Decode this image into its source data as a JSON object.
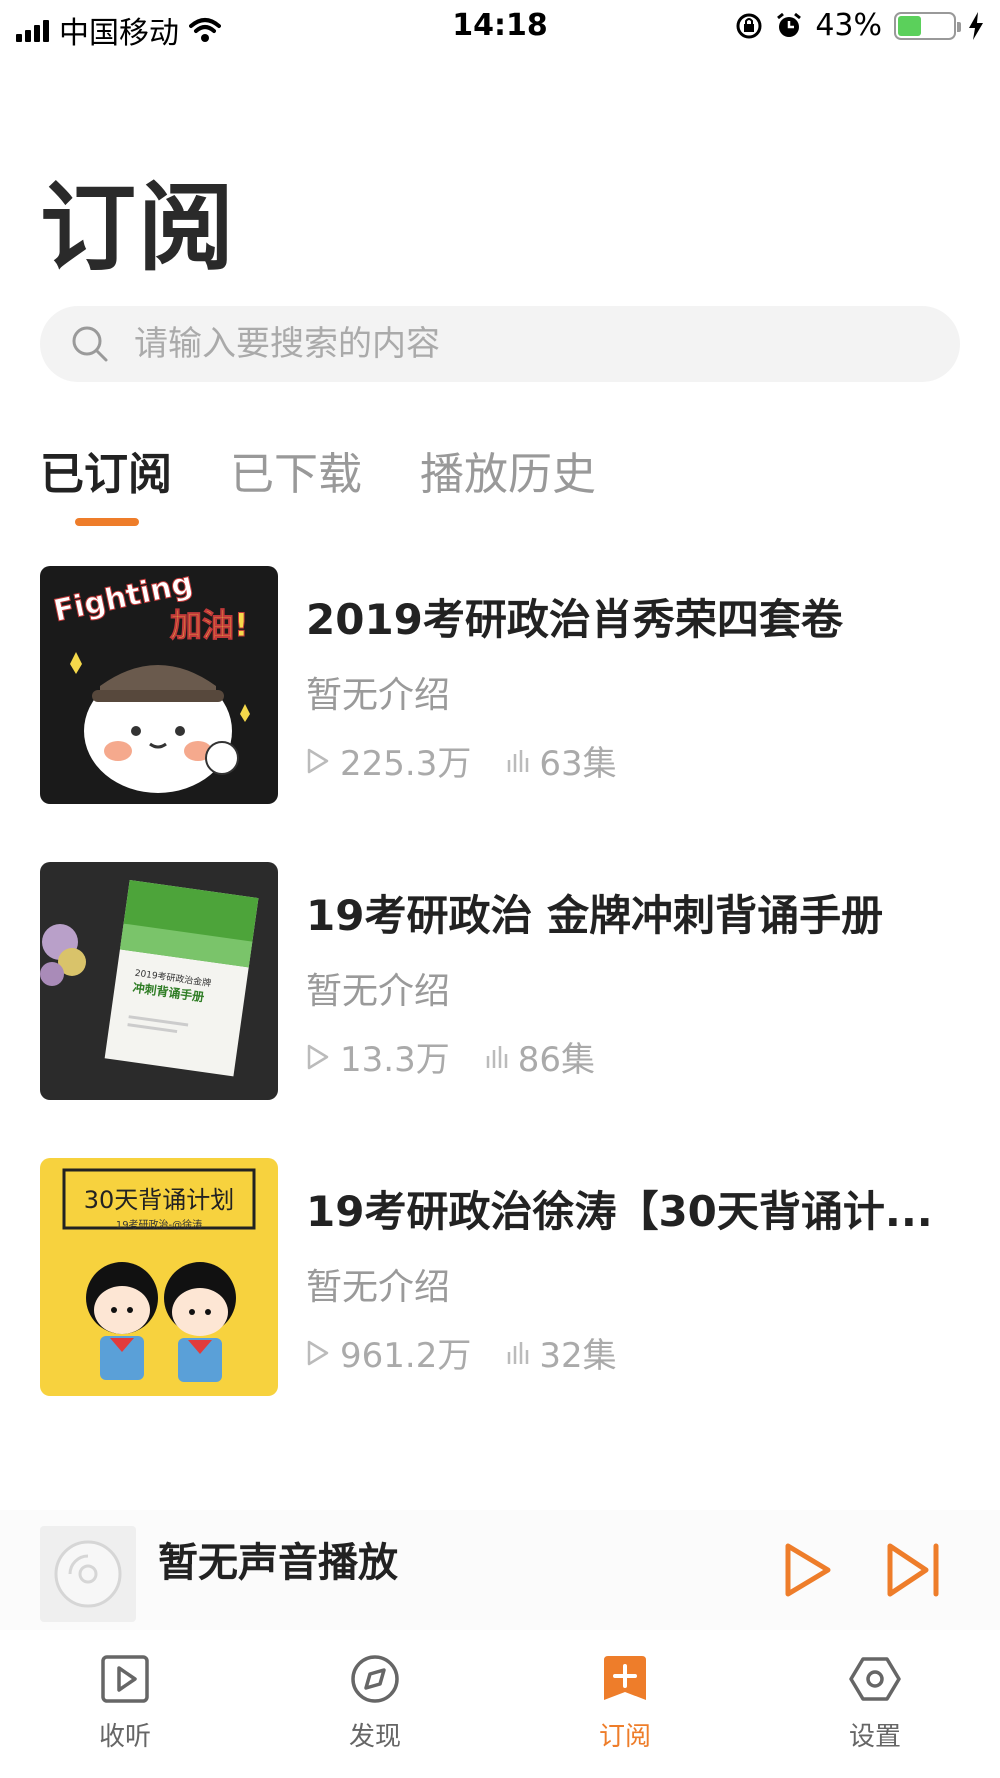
{
  "status_bar": {
    "carrier": "中国移动",
    "time": "14:18",
    "battery": "43%",
    "battery_level": 0.43
  },
  "page": {
    "title": "订阅"
  },
  "search": {
    "placeholder": "请输入要搜索的内容"
  },
  "tabs": [
    {
      "label": "已订阅",
      "active": true
    },
    {
      "label": "已下载",
      "active": false
    },
    {
      "label": "播放历史",
      "active": false
    }
  ],
  "subscriptions": [
    {
      "title": "2019考研政治肖秀荣四套卷",
      "desc": "暂无介绍",
      "plays": "225.3万",
      "episodes": "63集",
      "cover_text_1": "Fighting",
      "cover_text_2": "加油!"
    },
    {
      "title": "19考研政治 金牌冲刺背诵手册",
      "desc": "暂无介绍",
      "plays": "13.3万",
      "episodes": "86集",
      "cover_text_1": "2019考研政治金牌",
      "cover_text_2": "冲刺背诵手册"
    },
    {
      "title": "19考研政治徐涛【30天背诵计...",
      "desc": "暂无介绍",
      "plays": "961.2万",
      "episodes": "32集",
      "cover_text_1": "30天背诵计划",
      "cover_text_2": "19考研政治-@徐涛"
    }
  ],
  "player": {
    "text": "暂无声音播放"
  },
  "tabbar": [
    {
      "label": "收听",
      "icon": "listen-icon"
    },
    {
      "label": "发现",
      "icon": "compass-icon"
    },
    {
      "label": "订阅",
      "icon": "subscribe-icon",
      "active": true
    },
    {
      "label": "设置",
      "icon": "settings-icon"
    }
  ],
  "colors": {
    "accent": "#ee7d2a",
    "cover3_bg": "#f7d23e",
    "text_secondary": "#999999"
  }
}
